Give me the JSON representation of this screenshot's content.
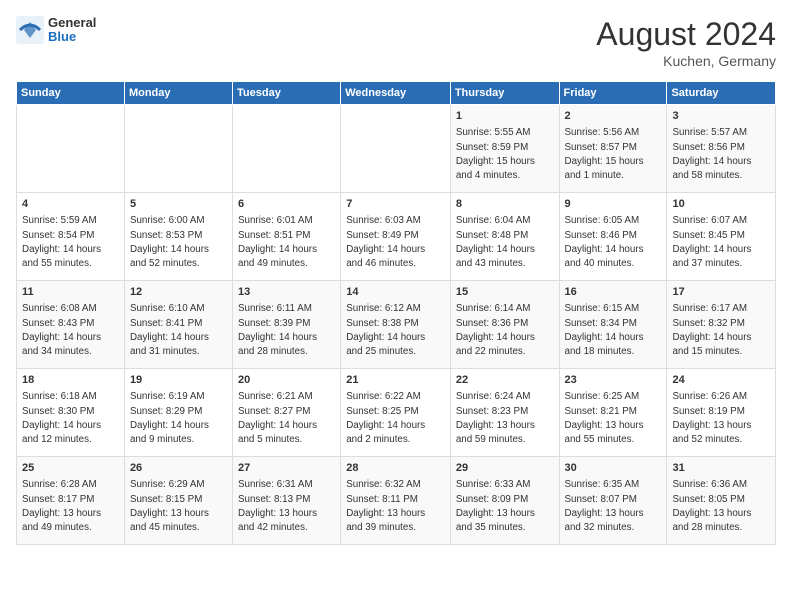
{
  "header": {
    "logo_general": "General",
    "logo_blue": "Blue",
    "month_year": "August 2024",
    "location": "Kuchen, Germany"
  },
  "days_of_week": [
    "Sunday",
    "Monday",
    "Tuesday",
    "Wednesday",
    "Thursday",
    "Friday",
    "Saturday"
  ],
  "weeks": [
    [
      {
        "day": "",
        "info": ""
      },
      {
        "day": "",
        "info": ""
      },
      {
        "day": "",
        "info": ""
      },
      {
        "day": "",
        "info": ""
      },
      {
        "day": "1",
        "info": "Sunrise: 5:55 AM\nSunset: 8:59 PM\nDaylight: 15 hours\nand 4 minutes."
      },
      {
        "day": "2",
        "info": "Sunrise: 5:56 AM\nSunset: 8:57 PM\nDaylight: 15 hours\nand 1 minute."
      },
      {
        "day": "3",
        "info": "Sunrise: 5:57 AM\nSunset: 8:56 PM\nDaylight: 14 hours\nand 58 minutes."
      }
    ],
    [
      {
        "day": "4",
        "info": "Sunrise: 5:59 AM\nSunset: 8:54 PM\nDaylight: 14 hours\nand 55 minutes."
      },
      {
        "day": "5",
        "info": "Sunrise: 6:00 AM\nSunset: 8:53 PM\nDaylight: 14 hours\nand 52 minutes."
      },
      {
        "day": "6",
        "info": "Sunrise: 6:01 AM\nSunset: 8:51 PM\nDaylight: 14 hours\nand 49 minutes."
      },
      {
        "day": "7",
        "info": "Sunrise: 6:03 AM\nSunset: 8:49 PM\nDaylight: 14 hours\nand 46 minutes."
      },
      {
        "day": "8",
        "info": "Sunrise: 6:04 AM\nSunset: 8:48 PM\nDaylight: 14 hours\nand 43 minutes."
      },
      {
        "day": "9",
        "info": "Sunrise: 6:05 AM\nSunset: 8:46 PM\nDaylight: 14 hours\nand 40 minutes."
      },
      {
        "day": "10",
        "info": "Sunrise: 6:07 AM\nSunset: 8:45 PM\nDaylight: 14 hours\nand 37 minutes."
      }
    ],
    [
      {
        "day": "11",
        "info": "Sunrise: 6:08 AM\nSunset: 8:43 PM\nDaylight: 14 hours\nand 34 minutes."
      },
      {
        "day": "12",
        "info": "Sunrise: 6:10 AM\nSunset: 8:41 PM\nDaylight: 14 hours\nand 31 minutes."
      },
      {
        "day": "13",
        "info": "Sunrise: 6:11 AM\nSunset: 8:39 PM\nDaylight: 14 hours\nand 28 minutes."
      },
      {
        "day": "14",
        "info": "Sunrise: 6:12 AM\nSunset: 8:38 PM\nDaylight: 14 hours\nand 25 minutes."
      },
      {
        "day": "15",
        "info": "Sunrise: 6:14 AM\nSunset: 8:36 PM\nDaylight: 14 hours\nand 22 minutes."
      },
      {
        "day": "16",
        "info": "Sunrise: 6:15 AM\nSunset: 8:34 PM\nDaylight: 14 hours\nand 18 minutes."
      },
      {
        "day": "17",
        "info": "Sunrise: 6:17 AM\nSunset: 8:32 PM\nDaylight: 14 hours\nand 15 minutes."
      }
    ],
    [
      {
        "day": "18",
        "info": "Sunrise: 6:18 AM\nSunset: 8:30 PM\nDaylight: 14 hours\nand 12 minutes."
      },
      {
        "day": "19",
        "info": "Sunrise: 6:19 AM\nSunset: 8:29 PM\nDaylight: 14 hours\nand 9 minutes."
      },
      {
        "day": "20",
        "info": "Sunrise: 6:21 AM\nSunset: 8:27 PM\nDaylight: 14 hours\nand 5 minutes."
      },
      {
        "day": "21",
        "info": "Sunrise: 6:22 AM\nSunset: 8:25 PM\nDaylight: 14 hours\nand 2 minutes."
      },
      {
        "day": "22",
        "info": "Sunrise: 6:24 AM\nSunset: 8:23 PM\nDaylight: 13 hours\nand 59 minutes."
      },
      {
        "day": "23",
        "info": "Sunrise: 6:25 AM\nSunset: 8:21 PM\nDaylight: 13 hours\nand 55 minutes."
      },
      {
        "day": "24",
        "info": "Sunrise: 6:26 AM\nSunset: 8:19 PM\nDaylight: 13 hours\nand 52 minutes."
      }
    ],
    [
      {
        "day": "25",
        "info": "Sunrise: 6:28 AM\nSunset: 8:17 PM\nDaylight: 13 hours\nand 49 minutes."
      },
      {
        "day": "26",
        "info": "Sunrise: 6:29 AM\nSunset: 8:15 PM\nDaylight: 13 hours\nand 45 minutes."
      },
      {
        "day": "27",
        "info": "Sunrise: 6:31 AM\nSunset: 8:13 PM\nDaylight: 13 hours\nand 42 minutes."
      },
      {
        "day": "28",
        "info": "Sunrise: 6:32 AM\nSunset: 8:11 PM\nDaylight: 13 hours\nand 39 minutes."
      },
      {
        "day": "29",
        "info": "Sunrise: 6:33 AM\nSunset: 8:09 PM\nDaylight: 13 hours\nand 35 minutes."
      },
      {
        "day": "30",
        "info": "Sunrise: 6:35 AM\nSunset: 8:07 PM\nDaylight: 13 hours\nand 32 minutes."
      },
      {
        "day": "31",
        "info": "Sunrise: 6:36 AM\nSunset: 8:05 PM\nDaylight: 13 hours\nand 28 minutes."
      }
    ]
  ]
}
